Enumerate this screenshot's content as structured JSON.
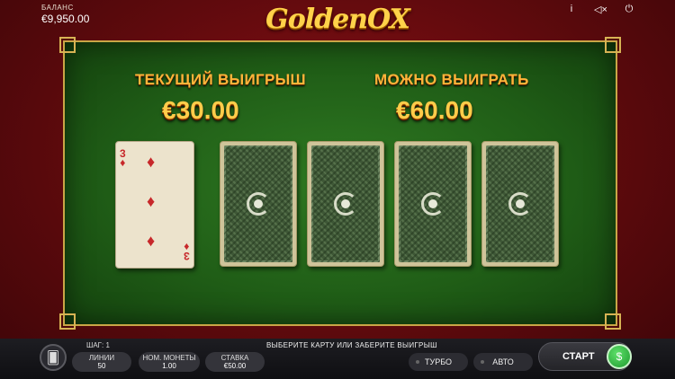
{
  "balance": {
    "label": "БАЛАНС",
    "value": "€9,950.00"
  },
  "logo": {
    "text": "GoldenOX"
  },
  "top_icons": {
    "info": "i",
    "mute": "◁×",
    "power": "⏻"
  },
  "game": {
    "current_win_label": "ТЕКУЩИЙ ВЫИГРЫШ",
    "current_win_value": "€30.00",
    "possible_win_label": "МОЖНО ВЫИГРАТЬ",
    "possible_win_value": "€60.00",
    "face_card": {
      "rank": "3",
      "suit": "♦"
    }
  },
  "bottom": {
    "step": "ШАГ: 1",
    "instruction": "ВЫБЕРИТЕ КАРТУ ИЛИ ЗАБЕРИТЕ ВЫИГРЫШ",
    "lines_label": "ЛИНИИ",
    "lines_value": "50",
    "coin_label": "НОМ. МОНЕТЫ",
    "coin_value": "1.00",
    "bet_label": "СТАВКА",
    "bet_value": "€50.00",
    "turbo_label": "ТУРБО",
    "auto_label": "АВТО",
    "start_label": "СТАРТ"
  }
}
